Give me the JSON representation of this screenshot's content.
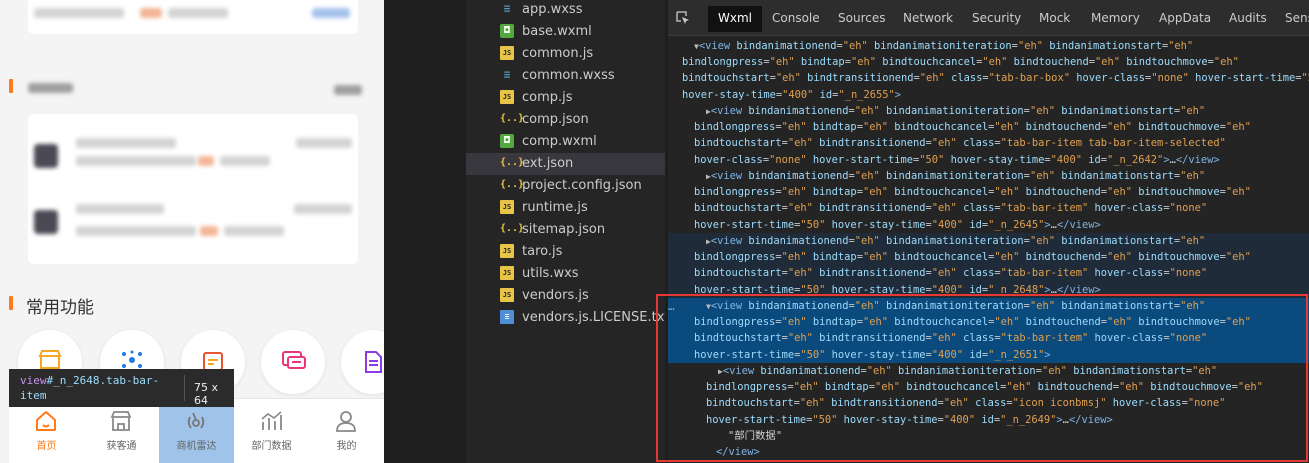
{
  "simulator": {
    "section_title": "常用功能",
    "tooltip": {
      "tag": "view",
      "selector": "#_n_2648.tab-bar-item",
      "size": "75 x 64"
    },
    "tabbar": [
      {
        "label": "首页",
        "icon": "home-icon",
        "active": true
      },
      {
        "label": "获客通",
        "icon": "shop-icon",
        "active": false
      },
      {
        "label": "商机雷达",
        "icon": "radar-icon",
        "active": false,
        "highlighted": true
      },
      {
        "label": "部门数据",
        "icon": "chart-icon",
        "active": false
      },
      {
        "label": "我的",
        "icon": "user-icon",
        "active": false
      }
    ],
    "function_icons": [
      "shop-icon",
      "dots-icon",
      "calendar-icon",
      "message-icon",
      "document-icon"
    ],
    "colors": {
      "accent": "#ff7a1a",
      "highlight": "#9fc3e9"
    }
  },
  "file_tree": {
    "files": [
      {
        "name": "app.wxss",
        "type": "css"
      },
      {
        "name": "base.wxml",
        "type": "wxml"
      },
      {
        "name": "common.js",
        "type": "js"
      },
      {
        "name": "common.wxss",
        "type": "css"
      },
      {
        "name": "comp.js",
        "type": "js"
      },
      {
        "name": "comp.json",
        "type": "json"
      },
      {
        "name": "comp.wxml",
        "type": "wxml"
      },
      {
        "name": "ext.json",
        "type": "json",
        "selected": true
      },
      {
        "name": "project.config.json",
        "type": "json"
      },
      {
        "name": "runtime.js",
        "type": "js"
      },
      {
        "name": "sitemap.json",
        "type": "json"
      },
      {
        "name": "taro.js",
        "type": "js"
      },
      {
        "name": "utils.wxs",
        "type": "js"
      },
      {
        "name": "vendors.js",
        "type": "js"
      },
      {
        "name": "vendors.js.LICENSE.txt",
        "type": "txt"
      }
    ]
  },
  "devtools": {
    "tabs": [
      "Wxml",
      "Console",
      "Sources",
      "Network",
      "Security",
      "Mock",
      "Memory",
      "AppData",
      "Audits",
      "Sens"
    ],
    "active_tab": "Wxml",
    "text_node": "\"部门数据\"",
    "close_tag": "</view>",
    "tab_bar_box": {
      "class": "tab-bar-box",
      "hover_class": "none",
      "hover_start_time": "50",
      "hover_stay_time": "400",
      "id": "_n_2655"
    },
    "items": [
      {
        "class": "tab-bar-item tab-bar-item-selected",
        "id": "_n_2642"
      },
      {
        "class": "tab-bar-item",
        "id": "_n_2645"
      },
      {
        "class": "tab-bar-item",
        "id": "_n_2648"
      },
      {
        "class": "tab-bar-item",
        "id": "_n_2651"
      }
    ],
    "child": {
      "class": "icon iconbmsj",
      "id": "_n_2649"
    }
  }
}
